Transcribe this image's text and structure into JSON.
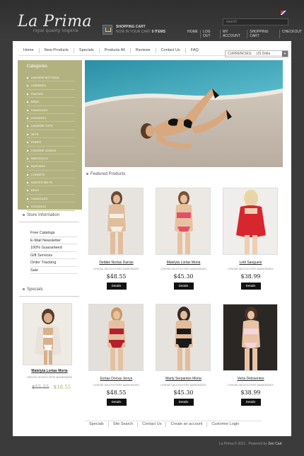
{
  "brand": {
    "name": "La Prima",
    "tagline": "royal quality lingerie"
  },
  "header": {
    "cart_title": "SHOPPING CART",
    "cart_status_prefix": "NOW IN YOUR CART",
    "cart_status_count": "0 ITEMS",
    "search_placeholder": "search",
    "top_links": [
      "HOME",
      "LOG OUT",
      "MY ACCOUNT",
      "SHOPPING CART",
      "CHECKOUT"
    ]
  },
  "nav": [
    "Home",
    "New Products",
    "Specials",
    "Products All",
    "Reviews",
    "Contact Us",
    "FAQ"
  ],
  "currency": {
    "label": "CURRENCIES:",
    "value": "US Dolla"
  },
  "categories": {
    "title": "Categories",
    "items": [
      "LINGERIE BOTTOMS",
      "CHEMISES",
      "PANTIES",
      "BRAS",
      "CAMISOLES",
      "LEGGINGS",
      "LINGERIE TOPS",
      "SETS",
      "ROBES",
      "LINGERIE GOWNS",
      "BABYDOLLS",
      "BUSTIERS",
      "CORSETS",
      "GARTER BELTS",
      "BRAS",
      "CAMISOLES",
      "LEGGINGS"
    ]
  },
  "store_info": {
    "title": "Store Information",
    "links": [
      "Free Catalogs",
      "E-Mail Newsletter",
      "100% Guaranteed",
      "Gift Services",
      "Order Tracking",
      "Sale"
    ]
  },
  "specials": {
    "title": "Specials",
    "item": {
      "name": "Malelyta Lortas Moria",
      "desc": "LEROSE DELEFIO FERS MASIERADES",
      "old_price": "$55.55",
      "new_price": "$18.55"
    }
  },
  "featured": {
    "title": "Featured Products",
    "products": [
      {
        "name": "Debbie Nortas Darras",
        "desc": "LEROSE DELEFIO FERS MASIERADES",
        "price": "$48.55",
        "button": "Details"
      },
      {
        "name": "Malelyta Lortas Moria",
        "desc": "LEROSE DELEFIO FERS MASIERADES",
        "price": "$45.30",
        "button": "Details"
      },
      {
        "name": "Letti Sanguelo",
        "desc": "LEROSE DELEFIO FERS MASIERADES",
        "price": "$38.99",
        "button": "Details"
      },
      {
        "name": "Esrtas Dorras Jerrys",
        "desc": "LEROSE DELEFIO FERS MASIERADES",
        "price": "$48.55",
        "button": "Details"
      },
      {
        "name": "Marty Serpantos Morta",
        "desc": "LEROSE DELEFIO FERS MASIERADES",
        "price": "$45.30",
        "button": "Details"
      },
      {
        "name": "Verta Delosentos",
        "desc": "LEROSE DELEFIO FERS MASIERADES",
        "price": "$38.99",
        "button": "Details"
      }
    ]
  },
  "footer": {
    "links": [
      "Specials",
      "Site Search",
      "Contact Us",
      "Create an account",
      "Customer Login"
    ],
    "copyright": "La Prima © 2011 . Powered by",
    "powered": "Zen Cart"
  }
}
